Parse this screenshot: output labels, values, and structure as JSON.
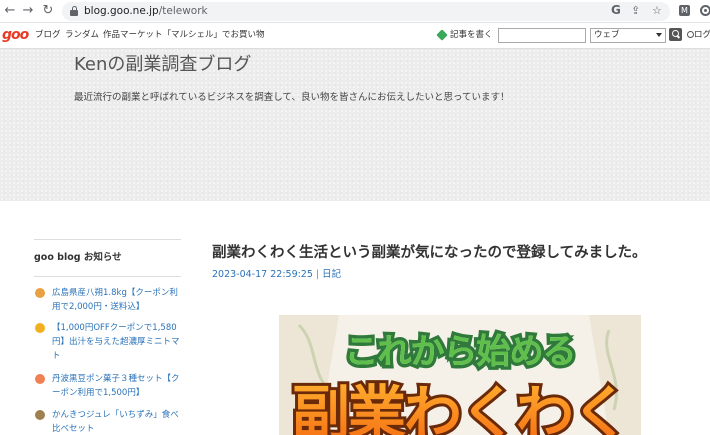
{
  "browser": {
    "url_host": "blog.goo.ne.jp",
    "url_path": "/telework"
  },
  "goo_header": {
    "logo": "goo",
    "links": [
      "ブログ",
      "ランダム",
      "作品マーケット「マルシェル」でお買い物"
    ],
    "write_label": "記事を書く",
    "search_placeholder": "",
    "search_scope": "ウェブ",
    "login_label": "ログイ"
  },
  "blog": {
    "title": "Kenの副業調査ブログ",
    "description": "最近流行の副業と呼ばれているビジネスを調査して、良い物を皆さんにお伝えしたいと思っています！"
  },
  "sidebar": {
    "title": "goo blog お知らせ",
    "notices": [
      {
        "text": "広島県産八朔1.8kg【クーポン利用で2,000円・送料込】",
        "icon": "dog-icon",
        "color": "#e8a040"
      },
      {
        "text": "【1,000円OFFクーポンで1,580円】出汁を与えた超濃厚ミニトマト",
        "icon": "sun-icon",
        "color": "#f0b020"
      },
      {
        "text": "丹波黒豆ポン菓子３種セット【クーポン利用で1,500円】",
        "icon": "flower-icon",
        "color": "#f08050"
      },
      {
        "text": "かんきつジュレ「いちずみ」食べ比べセット",
        "icon": "owl-icon",
        "color": "#a08050"
      }
    ]
  },
  "article": {
    "title": "副業わくわく生活という副業が気になったので登録してみました。",
    "datetime": "2023-04-17 22:59:25",
    "separator": "|",
    "category": "日記",
    "image_text_line1": "これから始める",
    "image_text_line2": "副業わくわく"
  }
}
